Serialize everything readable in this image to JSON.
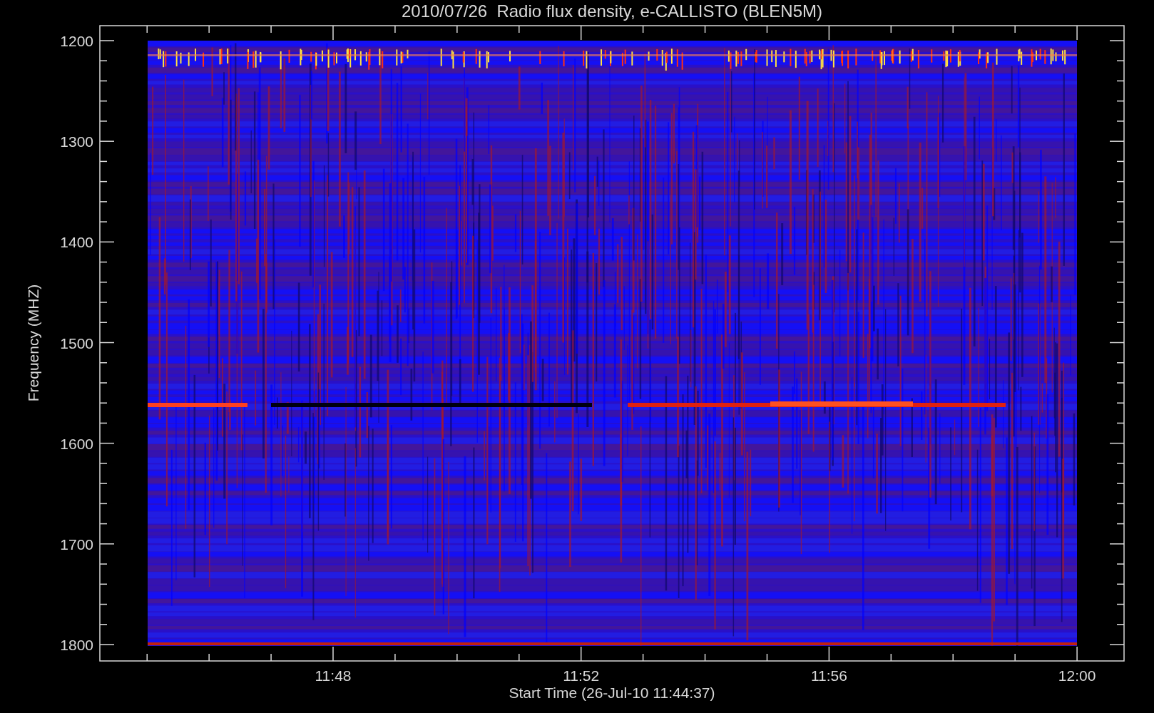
{
  "title": "2010/07/26  Radio flux density, e-CALLISTO (BLEN5M)",
  "y_axis": {
    "label": "Frequency (MHZ)",
    "ticks": [
      "1200",
      "1300",
      "1400",
      "1500",
      "1600",
      "1700",
      "1800"
    ]
  },
  "x_axis": {
    "label": "Start Time (26-Jul-10 11:44:37)",
    "ticks": [
      "11:48",
      "11:52",
      "11:56",
      "12:00"
    ]
  }
}
